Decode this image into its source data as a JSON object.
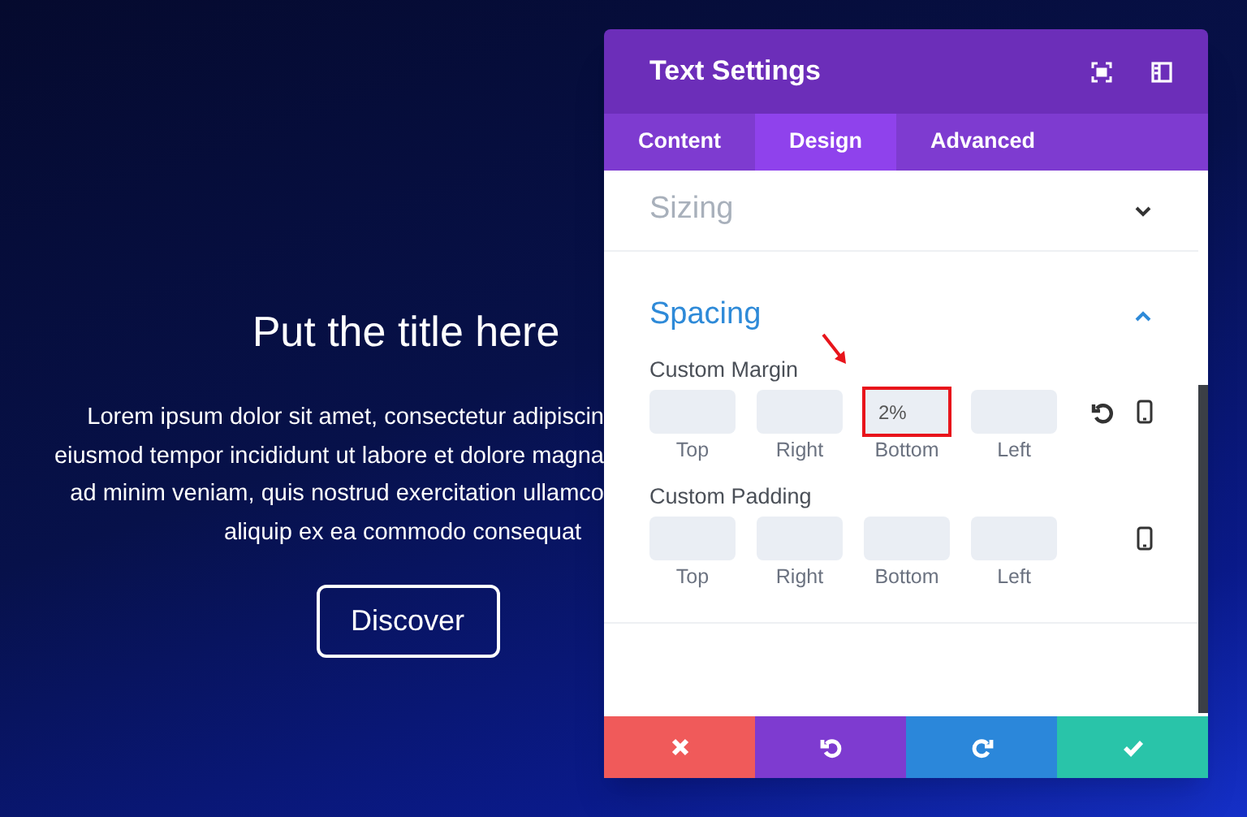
{
  "hero": {
    "title": "Put the title here",
    "lines": [
      "Lorem ipsum dolor sit amet, consectetur adipiscin",
      "eiusmod tempor incididunt ut labore et dolore magna",
      "ad minim veniam, quis nostrud exercitation ullamco"
    ],
    "last_line": "aliquip ex ea commodo consequat",
    "button": "Discover"
  },
  "modal": {
    "title": "Text Settings",
    "tabs": [
      {
        "label": "Content",
        "selected": false
      },
      {
        "label": "Design",
        "selected": true
      },
      {
        "label": "Advanced",
        "selected": false
      }
    ],
    "sections": [
      {
        "title": "Sizing",
        "expanded": false
      },
      {
        "title": "Spacing",
        "expanded": true
      }
    ],
    "groups": [
      {
        "label": "Custom Margin",
        "has_reset": true,
        "fields": [
          {
            "caption": "Top",
            "highlighted": false
          },
          {
            "caption": "Right",
            "highlighted": false
          },
          {
            "value": "2%",
            "caption": "Bottom",
            "highlighted": true
          },
          {
            "caption": "Left",
            "highlighted": false
          }
        ]
      },
      {
        "label": "Custom Padding",
        "has_reset": false,
        "fields": [
          {
            "caption": "Top",
            "highlighted": false
          },
          {
            "caption": "Right",
            "highlighted": false
          },
          {
            "caption": "Bottom",
            "highlighted": false
          },
          {
            "caption": "Left",
            "highlighted": false
          }
        ]
      }
    ],
    "footer": [
      {
        "kind": "cancel"
      },
      {
        "kind": "undo"
      },
      {
        "kind": "redo"
      },
      {
        "kind": "save"
      }
    ]
  }
}
